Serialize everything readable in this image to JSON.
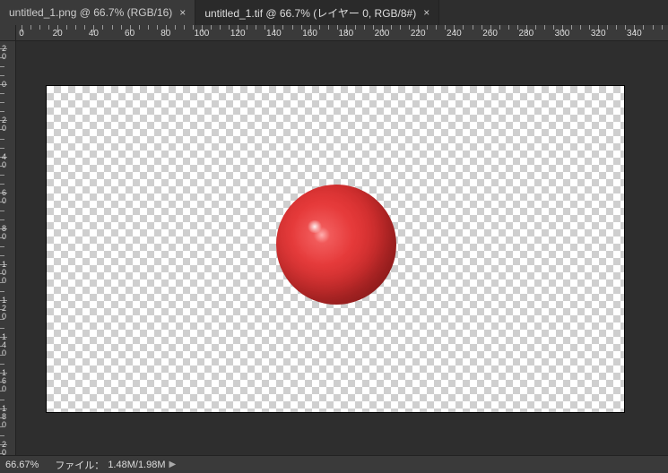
{
  "tabs": [
    {
      "label": "untitled_1.png @ 66.7% (RGB/16)",
      "active": false
    },
    {
      "label": "untitled_1.tif @ 66.7% (レイヤー 0, RGB/8#)",
      "active": true
    }
  ],
  "ruler": {
    "h": [
      "0",
      "20",
      "40",
      "60",
      "80",
      "100",
      "120",
      "140",
      "160",
      "180",
      "200",
      "220",
      "240",
      "260",
      "280",
      "300",
      "320",
      "340"
    ],
    "v": [
      "20",
      "0",
      "20",
      "40",
      "60",
      "80",
      "100",
      "120",
      "140",
      "160",
      "180",
      "200"
    ]
  },
  "status": {
    "zoom": "66.67%",
    "file_label": "ファイル：",
    "file_value": "1.48M/1.98M"
  },
  "canvas": {
    "zoom_percent": 66.7,
    "content": "red-sphere-on-transparent"
  }
}
